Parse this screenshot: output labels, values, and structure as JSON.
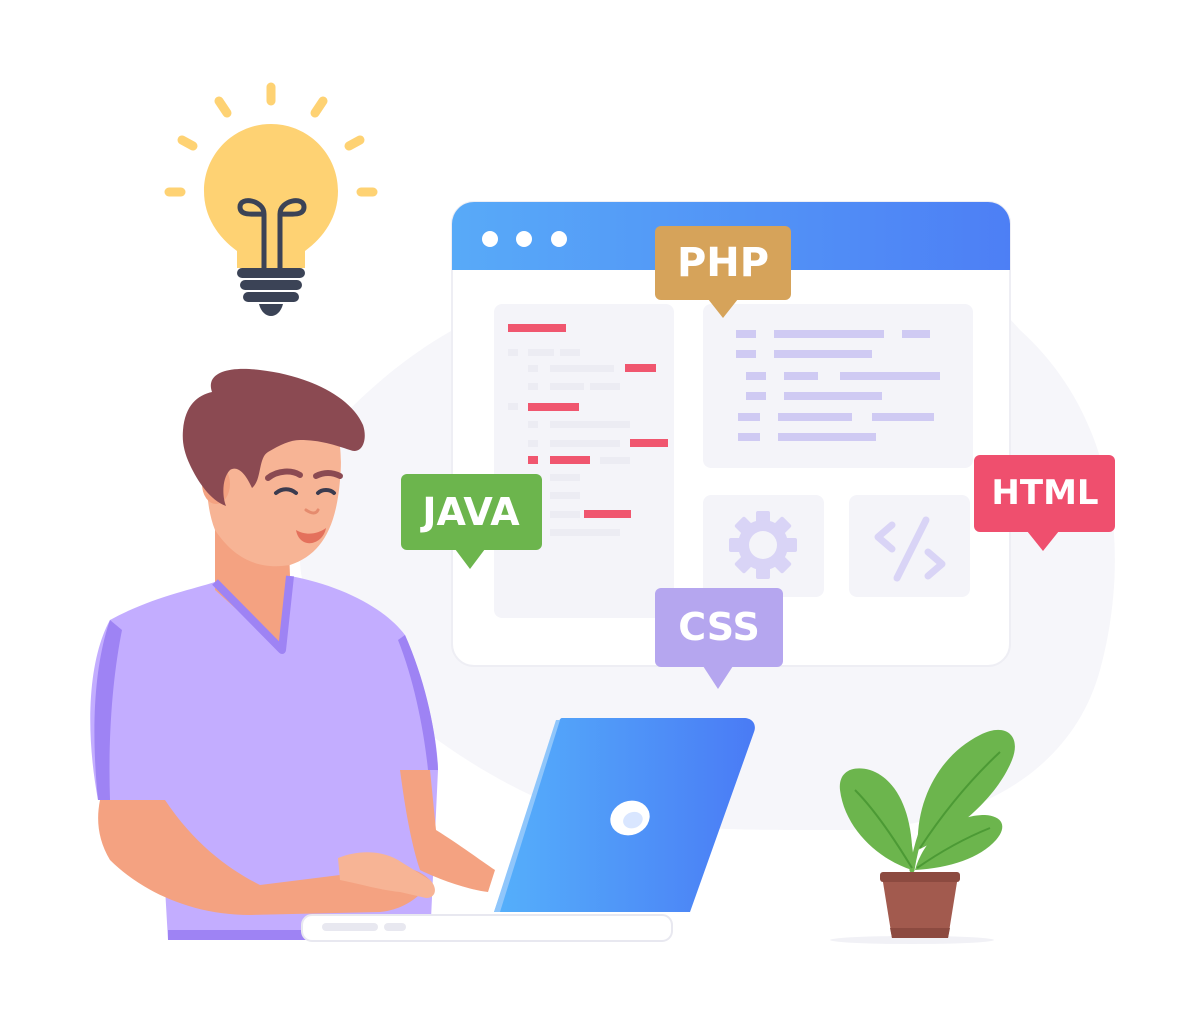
{
  "tags": {
    "php": {
      "label": "PHP",
      "color": "#d6a35a"
    },
    "java": {
      "label": "JAVA",
      "color": "#6cb54d"
    },
    "html": {
      "label": "HTML",
      "color": "#ef4f6e"
    },
    "css": {
      "label": "CSS",
      "color": "#b5a6ef"
    }
  },
  "colors": {
    "browser_header": "#4f8cf7",
    "browser_body": "#ffffff",
    "panel": "#f4f4f9",
    "code_red": "#f0566f",
    "code_gray": "#ececf3",
    "code_purple": "#cfcaf3",
    "laptop": "#4f8cf7",
    "shirt": "#c3adff",
    "hair": "#8b4a52",
    "skin": "#f4a281",
    "bulb": "#fed273",
    "leaf": "#6cb54d",
    "pot": "#a25a4e"
  },
  "icons": {
    "bulb": "lightbulb-icon",
    "gear": "gear-icon",
    "code": "code-icon",
    "laptop_logo": "laptop-logo-icon",
    "plant": "plant-icon"
  }
}
